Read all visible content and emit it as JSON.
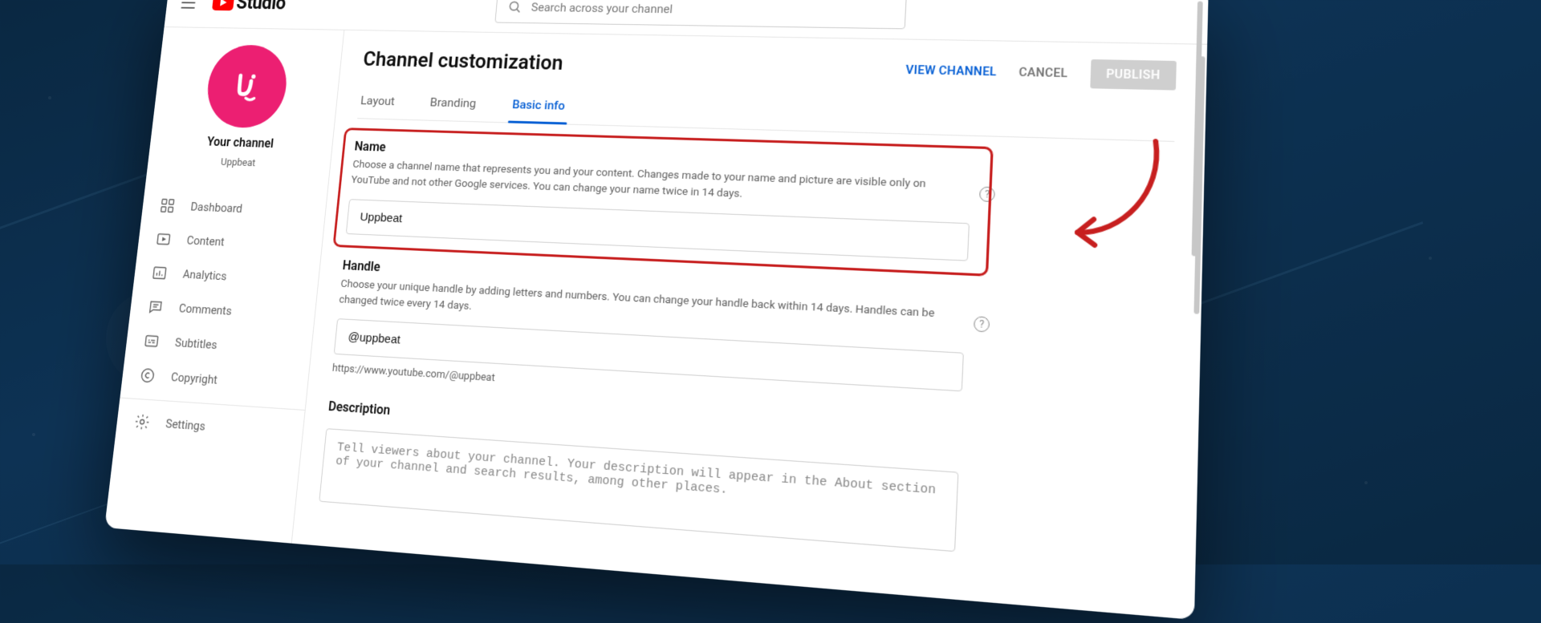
{
  "header": {
    "logo_text": "Studio",
    "search_placeholder": "Search across your channel"
  },
  "sidebar": {
    "your_channel_label": "Your channel",
    "channel_name": "Uppbeat",
    "items": [
      {
        "label": "Dashboard"
      },
      {
        "label": "Content"
      },
      {
        "label": "Analytics"
      },
      {
        "label": "Comments"
      },
      {
        "label": "Subtitles"
      },
      {
        "label": "Copyright"
      }
    ],
    "settings_label": "Settings"
  },
  "main": {
    "title": "Channel customization",
    "actions": {
      "view_channel": "VIEW CHANNEL",
      "cancel": "CANCEL",
      "publish": "PUBLISH"
    },
    "tabs": [
      {
        "label": "Layout"
      },
      {
        "label": "Branding"
      },
      {
        "label": "Basic info"
      }
    ],
    "name_section": {
      "title": "Name",
      "desc": "Choose a channel name that represents you and your content. Changes made to your name and picture are visible only on YouTube and not other Google services. You can change your name twice in 14 days.",
      "value": "Uppbeat"
    },
    "handle_section": {
      "title": "Handle",
      "desc": "Choose your unique handle by adding letters and numbers. You can change your handle back within 14 days. Handles can be changed twice every 14 days.",
      "value": "@uppbeat",
      "url_line": "https://www.youtube.com/@uppbeat"
    },
    "description_section": {
      "title": "Description",
      "placeholder": "Tell viewers about your channel. Your description will appear in the About section of your channel and search results, among other places."
    }
  }
}
